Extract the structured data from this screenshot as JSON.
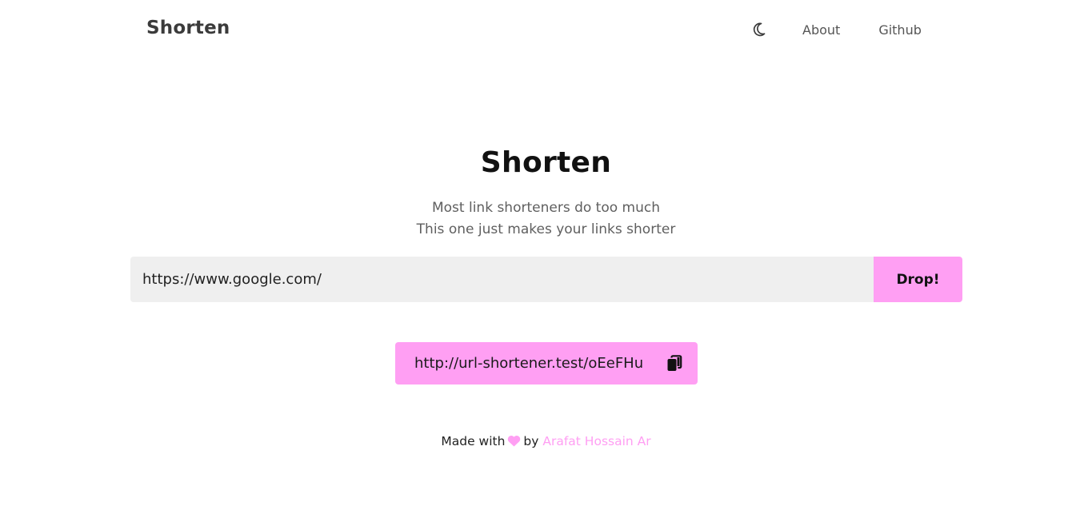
{
  "header": {
    "brand": "Shorten",
    "theme_toggle_icon": "moon-icon",
    "nav": {
      "about": "About",
      "github": "Github"
    }
  },
  "hero": {
    "title": "Shorten",
    "tagline_line1": "Most link shorteners do too much",
    "tagline_line2": "This one just makes your links shorter"
  },
  "form": {
    "url_value": "https://www.google.com/",
    "submit_label": "Drop!"
  },
  "result": {
    "short_url": "http://url-shortener.test/oEeFHu",
    "copy_icon": "copy-icon"
  },
  "footer": {
    "made_with": "Made with",
    "heart_icon": "heart-icon",
    "by": "by",
    "author": "Arafat Hossain Ar"
  },
  "colors": {
    "accent": "#ff9ff3",
    "input_bg": "#efefef",
    "text_dark": "#111111",
    "text_muted": "#5f5f5f"
  }
}
